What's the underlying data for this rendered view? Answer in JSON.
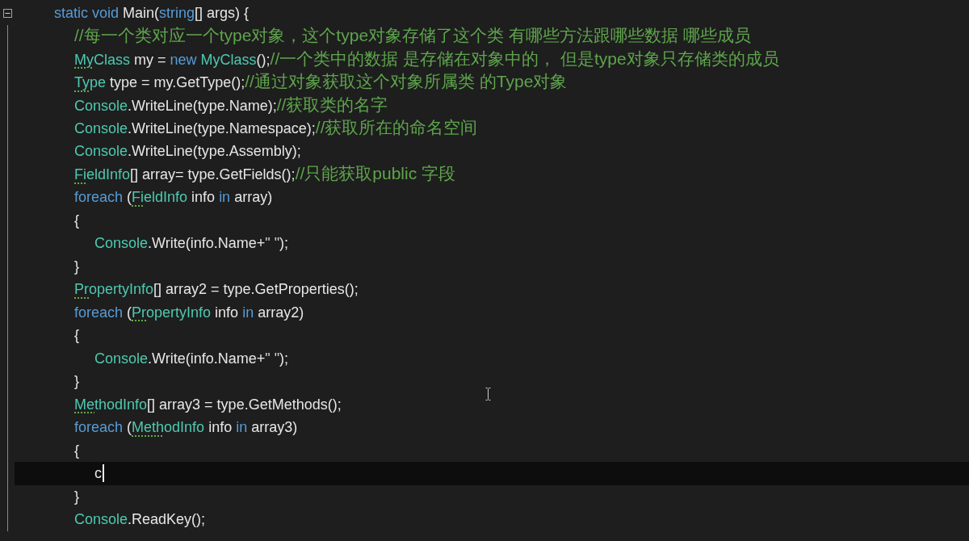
{
  "editor": {
    "lines": [
      {
        "expanded": true,
        "current": false,
        "tokens": [
          {
            "kind": "keyword",
            "text": "static void"
          },
          {
            "kind": "plain",
            "text": " Main("
          },
          {
            "kind": "keyword",
            "text": "string"
          },
          {
            "kind": "plain",
            "text": "[] args) {"
          }
        ],
        "children": [
          {
            "current": false,
            "tokens": [
              {
                "kind": "comment",
                "text": "//每一个类对应一个type对象，这个type对象存储了这个类 有哪些方法跟哪些数据 哪些成员"
              }
            ]
          },
          {
            "current": false,
            "tokens": [
              {
                "kind": "hinted",
                "text": "My"
              },
              {
                "kind": "type",
                "text": "Class"
              },
              {
                "kind": "plain",
                "text": " my = "
              },
              {
                "kind": "keyword",
                "text": "new"
              },
              {
                "kind": "type",
                "text": " MyClass"
              },
              {
                "kind": "plain",
                "text": "();"
              },
              {
                "kind": "comment",
                "text": "//一个类中的数据 是存储在对象中的， 但是type对象只存储类的成员"
              }
            ]
          },
          {
            "current": false,
            "tokens": [
              {
                "kind": "hinted",
                "text": "Ty"
              },
              {
                "kind": "type",
                "text": "pe"
              },
              {
                "kind": "plain",
                "text": " type = my.GetType();"
              },
              {
                "kind": "comment",
                "text": "//通过对象获取这个对象所属类 的Type对象"
              }
            ]
          },
          {
            "current": false,
            "tokens": [
              {
                "kind": "type",
                "text": "Console"
              },
              {
                "kind": "plain",
                "text": ".WriteLine(type.Name);"
              },
              {
                "kind": "comment",
                "text": "//获取类的名字"
              }
            ]
          },
          {
            "current": false,
            "tokens": [
              {
                "kind": "type",
                "text": "Console"
              },
              {
                "kind": "plain",
                "text": ".WriteLine(type.Namespace);"
              },
              {
                "kind": "comment",
                "text": "//获取所在的命名空间"
              }
            ]
          },
          {
            "current": false,
            "tokens": [
              {
                "kind": "type",
                "text": "Console"
              },
              {
                "kind": "plain",
                "text": ".WriteLine(type.Assembly);"
              }
            ]
          },
          {
            "current": false,
            "tokens": [
              {
                "kind": "hinted",
                "text": "Fi"
              },
              {
                "kind": "type",
                "text": "eldInfo"
              },
              {
                "kind": "plain",
                "text": "[] array= type.GetFields();"
              },
              {
                "kind": "comment",
                "text": "//只能获取public 字段"
              }
            ]
          },
          {
            "current": false,
            "tokens": [
              {
                "kind": "keyword",
                "text": "foreach"
              },
              {
                "kind": "plain",
                "text": " ("
              },
              {
                "kind": "hinted",
                "text": "Fi"
              },
              {
                "kind": "type",
                "text": "eldInfo"
              },
              {
                "kind": "plain",
                "text": " info "
              },
              {
                "kind": "keyword",
                "text": "in"
              },
              {
                "kind": "plain",
                "text": " array)"
              }
            ]
          },
          {
            "current": false,
            "tokens": [
              {
                "kind": "plain",
                "text": "{"
              }
            ],
            "children": [
              {
                "current": false,
                "tokens": [
                  {
                    "kind": "type",
                    "text": "Console"
                  },
                  {
                    "kind": "plain",
                    "text": ".Write(info.Name+"
                  },
                  {
                    "kind": "string",
                    "text": "\" \""
                  },
                  {
                    "kind": "plain",
                    "text": ");"
                  }
                ]
              }
            ]
          },
          {
            "current": false,
            "tokens": [
              {
                "kind": "plain",
                "text": "}"
              }
            ]
          },
          {
            "current": false,
            "tokens": [
              {
                "kind": "hinted",
                "text": "Pr"
              },
              {
                "kind": "type",
                "text": "opertyInfo"
              },
              {
                "kind": "plain",
                "text": "[] array2 = type.GetProperties();"
              }
            ]
          },
          {
            "current": false,
            "tokens": [
              {
                "kind": "keyword",
                "text": "foreach"
              },
              {
                "kind": "plain",
                "text": " ("
              },
              {
                "kind": "hinted",
                "text": "Pr"
              },
              {
                "kind": "type",
                "text": "opertyInfo"
              },
              {
                "kind": "plain",
                "text": " info "
              },
              {
                "kind": "keyword",
                "text": "in"
              },
              {
                "kind": "plain",
                "text": " array2)"
              }
            ]
          },
          {
            "current": false,
            "tokens": [
              {
                "kind": "plain",
                "text": "{"
              }
            ],
            "children": [
              {
                "current": false,
                "tokens": [
                  {
                    "kind": "type",
                    "text": "Console"
                  },
                  {
                    "kind": "plain",
                    "text": ".Write(info.Name+"
                  },
                  {
                    "kind": "string",
                    "text": "\" \""
                  },
                  {
                    "kind": "plain",
                    "text": ");"
                  }
                ]
              }
            ]
          },
          {
            "current": false,
            "tokens": [
              {
                "kind": "plain",
                "text": "}"
              }
            ]
          },
          {
            "current": false,
            "tokens": [
              {
                "kind": "hinted",
                "text": "Me"
              },
              {
                "kind": "type",
                "text": "thodInfo"
              },
              {
                "kind": "plain",
                "text": "[] array3 = type.GetMethods();"
              }
            ]
          },
          {
            "current": false,
            "tokens": [
              {
                "kind": "keyword",
                "text": "foreach"
              },
              {
                "kind": "plain",
                "text": " ("
              },
              {
                "kind": "hinted",
                "text": "Meth"
              },
              {
                "kind": "type",
                "text": "odInfo"
              },
              {
                "kind": "plain",
                "text": " info "
              },
              {
                "kind": "keyword",
                "text": "in"
              },
              {
                "kind": "plain",
                "text": " array3)"
              }
            ]
          },
          {
            "current": false,
            "tokens": [
              {
                "kind": "plain",
                "text": "{"
              }
            ],
            "children": [
              {
                "current": true,
                "tokens": [
                  {
                    "kind": "plain",
                    "text": "c"
                  }
                ]
              }
            ]
          },
          {
            "current": false,
            "tokens": [
              {
                "kind": "plain",
                "text": "}"
              }
            ]
          },
          {
            "current": false,
            "tokens": [
              {
                "kind": "type",
                "text": "Console"
              },
              {
                "kind": "plain",
                "text": ".ReadKey();"
              }
            ]
          }
        ]
      }
    ]
  }
}
